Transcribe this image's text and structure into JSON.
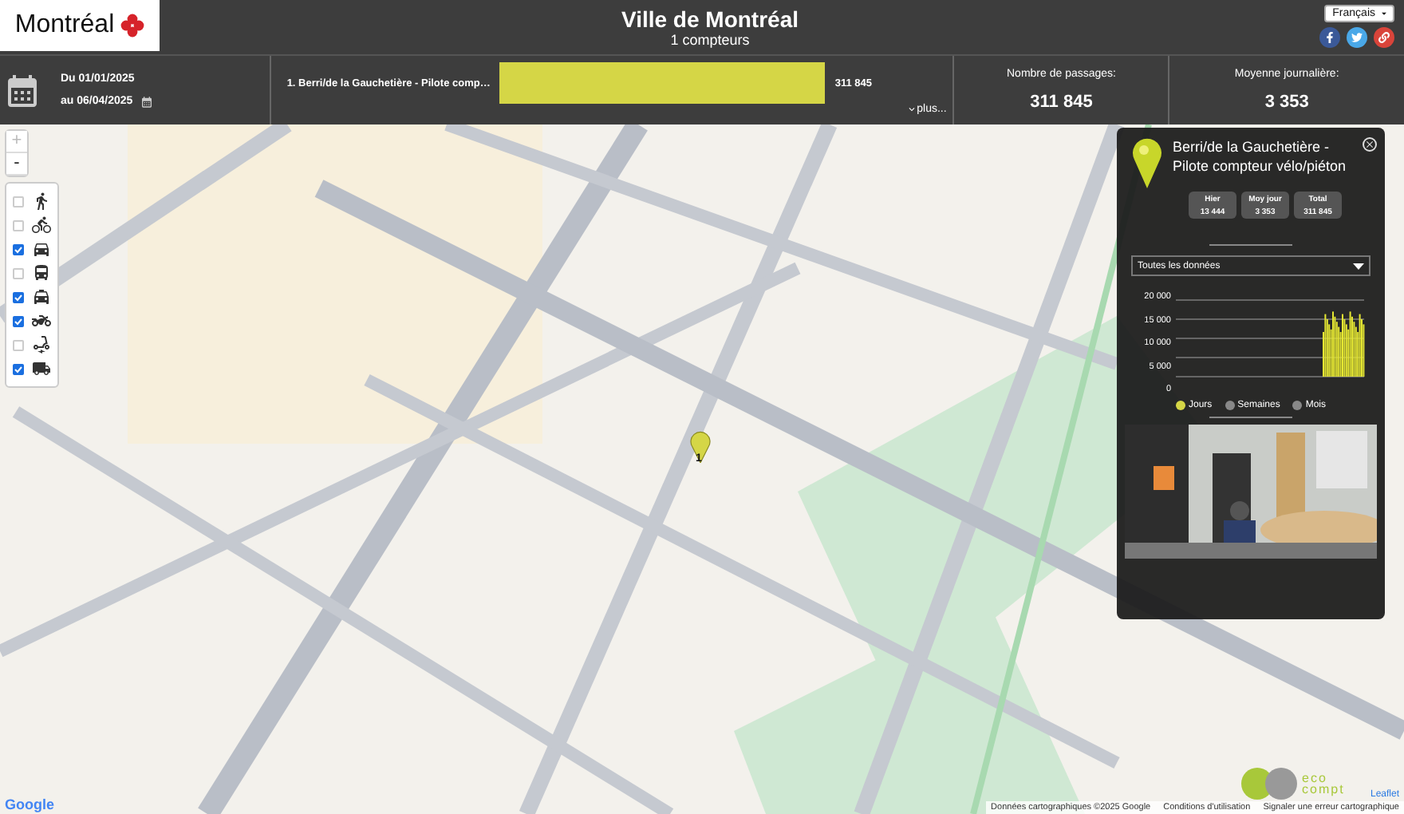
{
  "header": {
    "logo_text": "Montréal",
    "title": "Ville de Montréal",
    "subtitle": "1 compteurs",
    "language": "Français",
    "social": [
      {
        "kind": "facebook",
        "color": "#3b5998"
      },
      {
        "kind": "twitter",
        "color": "#4aa8e8"
      },
      {
        "kind": "link",
        "color": "#d9443a"
      }
    ]
  },
  "toolbar": {
    "date_from": "Du 01/01/2025",
    "date_to": "au 06/04/2025",
    "counters": [
      {
        "name": "1. Berri/de la Gauchetière - Pilote comp…",
        "level": 1,
        "value": "311 845"
      }
    ],
    "more": "plus...",
    "stats": [
      {
        "label": "Nombre de passages:",
        "value": "311 845"
      },
      {
        "label": "Moyenne journalière:",
        "value": "3 353"
      }
    ]
  },
  "map": {
    "zoom_in": {
      "label": "+",
      "disabled": true
    },
    "zoom_out": {
      "label": "-",
      "disabled": false
    },
    "filters": [
      {
        "kind": "walk",
        "checked": false
      },
      {
        "kind": "bike",
        "checked": false
      },
      {
        "kind": "car",
        "checked": true
      },
      {
        "kind": "bus",
        "checked": false
      },
      {
        "kind": "taxi",
        "checked": true
      },
      {
        "kind": "motorcycle",
        "checked": true
      },
      {
        "kind": "scooter",
        "checked": false
      },
      {
        "kind": "truck",
        "checked": true
      }
    ],
    "marker_label": "1",
    "popup": {
      "title": "Berri/de la Gauchetière - Pilote compteur vélo/piéton",
      "stats": [
        {
          "label": "Hier",
          "value": "13 444"
        },
        {
          "label": "Moy jour",
          "value": "3 353"
        },
        {
          "label": "Total",
          "value": "311 845"
        }
      ],
      "period": "Toutes les données",
      "yticks": [
        "20 000",
        "15 000",
        "10 000",
        "5 000",
        "0"
      ],
      "legend": [
        {
          "label": "Jours",
          "selected": true
        },
        {
          "label": "Semaines",
          "selected": false
        },
        {
          "label": "Mois",
          "selected": false
        }
      ]
    },
    "google_logo": "Google",
    "eco_logo": [
      "eco",
      "compt"
    ],
    "leaflet": "Leaflet",
    "attribution": [
      "Données cartographiques ©2025 Google",
      "Conditions d'utilisation",
      "Signaler une erreur cartographique"
    ]
  }
}
